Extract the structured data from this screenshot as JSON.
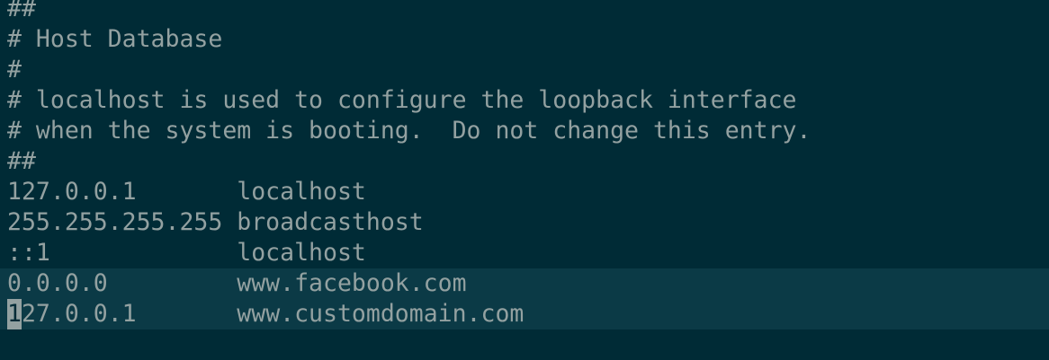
{
  "colors": {
    "background": "#002b36",
    "text": "#93a1a1",
    "highlight": "#0b3a46",
    "cursor": "#93a1a1"
  },
  "lines": [
    "##",
    "# Host Database",
    "#",
    "# localhost is used to configure the loopback interface",
    "# when the system is booting.  Do not change this entry.",
    "##",
    "127.0.0.1       localhost",
    "255.255.255.255 broadcasthost",
    "::1             localhost",
    "0.0.0.0         www.facebook.com"
  ],
  "cursor_line": {
    "cursor_char": "1",
    "rest": "27.0.0.1       www.customdomain.com"
  }
}
